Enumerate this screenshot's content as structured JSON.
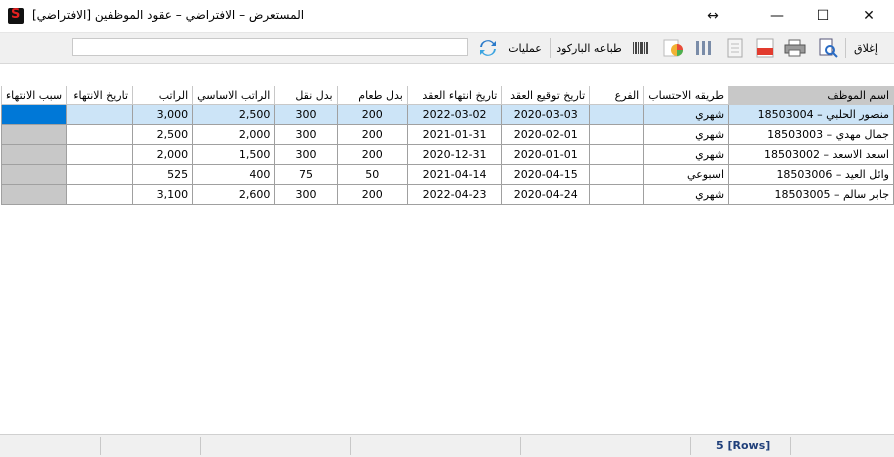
{
  "window": {
    "title": "المستعرض – الافتراضي – عقود الموظفين [الافتراضي]",
    "controls": {
      "restore": "↔",
      "minimize": "—",
      "maximize": "☐",
      "close": "✕"
    }
  },
  "toolbar": {
    "close_label": "إغلاق",
    "print_barcode_label": "طباعه الباركود",
    "operations_label": "عمليات",
    "search_placeholder": ""
  },
  "grid": {
    "columns": [
      "اسم الموظف",
      "طريقه الاحتساب",
      "الفرع",
      "تاريخ توقيع العقد",
      "تاريخ انتهاء العقد",
      "بدل طعام",
      "بدل نقل",
      "الراتب الاساسي",
      "الراتب",
      "تاريخ الانتهاء",
      "سبب الانتهاء"
    ],
    "rows": [
      {
        "name": "18503004 – منصور الحلبي",
        "method": "شهري",
        "branch": "",
        "sign_date": "2020-03-03",
        "end_date": "2022-03-02",
        "food": "200",
        "transport": "300",
        "basic": "2,500",
        "salary": "3,000",
        "term_date": "",
        "term_reason": ""
      },
      {
        "name": "18503003 – جمال مهدي",
        "method": "شهري",
        "branch": "",
        "sign_date": "2020-02-01",
        "end_date": "2021-01-31",
        "food": "200",
        "transport": "300",
        "basic": "2,000",
        "salary": "2,500",
        "term_date": "",
        "term_reason": ""
      },
      {
        "name": "18503002 – اسعد الاسعد",
        "method": "شهري",
        "branch": "",
        "sign_date": "2020-01-01",
        "end_date": "2020-12-31",
        "food": "200",
        "transport": "300",
        "basic": "1,500",
        "salary": "2,000",
        "term_date": "",
        "term_reason": ""
      },
      {
        "name": "18503006 – وائل العيد",
        "method": "اسبوعي",
        "branch": "",
        "sign_date": "2020-04-15",
        "end_date": "2021-04-14",
        "food": "50",
        "transport": "75",
        "basic": "400",
        "salary": "525",
        "term_date": "",
        "term_reason": ""
      },
      {
        "name": "18503005 – جابر سالم",
        "method": "شهري",
        "branch": "",
        "sign_date": "2020-04-24",
        "end_date": "2022-04-23",
        "food": "200",
        "transport": "300",
        "basic": "2,600",
        "salary": "3,100",
        "term_date": "",
        "term_reason": ""
      }
    ]
  },
  "status": {
    "rows_label": "5 [Rows]"
  }
}
